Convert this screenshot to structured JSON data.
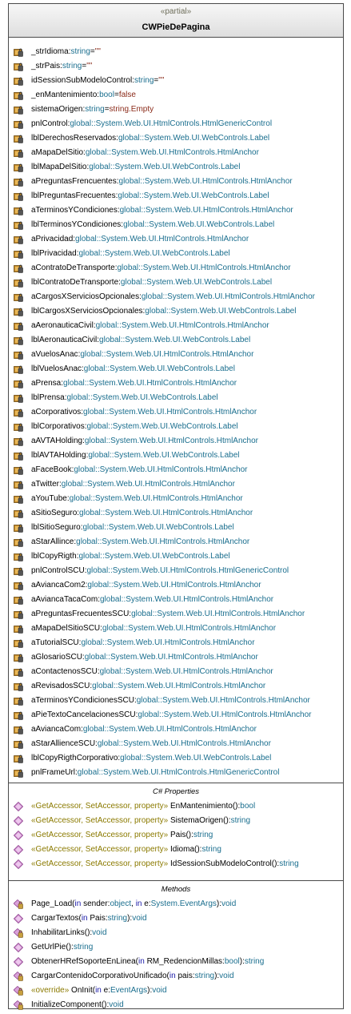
{
  "class": {
    "stereotype": "«partial»",
    "name": "CWPieDePagina"
  },
  "fields": [
    {
      "name": "_strIdioma",
      "type": "string",
      "default": "\"\""
    },
    {
      "name": "_strPais",
      "type": "string",
      "default": "\"\""
    },
    {
      "name": "idSessionSubModeloControl",
      "type": "string",
      "default": "\"\""
    },
    {
      "name": "_enMantenimiento",
      "type": "bool",
      "default": "false"
    },
    {
      "name": "sistemaOrigen",
      "type": "string",
      "default": "string.Empty"
    },
    {
      "name": "pnlControl",
      "type": "global::System.Web.UI.HtmlControls.HtmlGenericControl"
    },
    {
      "name": "lblDerechosReservados",
      "type": "global::System.Web.UI.WebControls.Label"
    },
    {
      "name": "aMapaDelSitio",
      "type": "global::System.Web.UI.HtmlControls.HtmlAnchor"
    },
    {
      "name": "lblMapaDelSitio",
      "type": "global::System.Web.UI.WebControls.Label"
    },
    {
      "name": "aPreguntasFrencuentes",
      "type": "global::System.Web.UI.HtmlControls.HtmlAnchor"
    },
    {
      "name": "lblPreguntasFrecuentes",
      "type": "global::System.Web.UI.WebControls.Label"
    },
    {
      "name": "aTerminosYCondiciones",
      "type": "global::System.Web.UI.HtmlControls.HtmlAnchor"
    },
    {
      "name": "lblTerminosYCondiciones",
      "type": "global::System.Web.UI.WebControls.Label"
    },
    {
      "name": "aPrivacidad",
      "type": "global::System.Web.UI.HtmlControls.HtmlAnchor"
    },
    {
      "name": "lblPrivacidad",
      "type": "global::System.Web.UI.WebControls.Label"
    },
    {
      "name": "aContratoDeTransporte",
      "type": "global::System.Web.UI.HtmlControls.HtmlAnchor"
    },
    {
      "name": "lblContratoDeTransporte",
      "type": "global::System.Web.UI.WebControls.Label"
    },
    {
      "name": "aCargosXServiciosOpcionales",
      "type": "global::System.Web.UI.HtmlControls.HtmlAnchor"
    },
    {
      "name": "lblCargosXServiciosOpcionales",
      "type": "global::System.Web.UI.WebControls.Label"
    },
    {
      "name": "aAeronauticaCivil",
      "type": "global::System.Web.UI.HtmlControls.HtmlAnchor"
    },
    {
      "name": "lblAeronauticaCivil",
      "type": "global::System.Web.UI.WebControls.Label"
    },
    {
      "name": "aVuelosAnac",
      "type": "global::System.Web.UI.HtmlControls.HtmlAnchor"
    },
    {
      "name": "lblVuelosAnac",
      "type": "global::System.Web.UI.WebControls.Label"
    },
    {
      "name": "aPrensa",
      "type": "global::System.Web.UI.HtmlControls.HtmlAnchor"
    },
    {
      "name": "lblPrensa",
      "type": "global::System.Web.UI.WebControls.Label"
    },
    {
      "name": "aCorporativos",
      "type": "global::System.Web.UI.HtmlControls.HtmlAnchor"
    },
    {
      "name": "lblCorporativos",
      "type": "global::System.Web.UI.WebControls.Label"
    },
    {
      "name": "aAVTAHolding",
      "type": "global::System.Web.UI.HtmlControls.HtmlAnchor"
    },
    {
      "name": "lblAVTAHolding",
      "type": "global::System.Web.UI.WebControls.Label"
    },
    {
      "name": "aFaceBook",
      "type": "global::System.Web.UI.HtmlControls.HtmlAnchor"
    },
    {
      "name": "aTwitter",
      "type": "global::System.Web.UI.HtmlControls.HtmlAnchor"
    },
    {
      "name": "aYouTube",
      "type": "global::System.Web.UI.HtmlControls.HtmlAnchor"
    },
    {
      "name": "aSitioSeguro",
      "type": "global::System.Web.UI.HtmlControls.HtmlAnchor"
    },
    {
      "name": "lblSitioSeguro",
      "type": "global::System.Web.UI.WebControls.Label"
    },
    {
      "name": "aStarAllince",
      "type": "global::System.Web.UI.HtmlControls.HtmlAnchor"
    },
    {
      "name": "lblCopyRigth",
      "type": "global::System.Web.UI.WebControls.Label"
    },
    {
      "name": "pnlControlSCU",
      "type": "global::System.Web.UI.HtmlControls.HtmlGenericControl"
    },
    {
      "name": "aAviancaCom2",
      "type": "global::System.Web.UI.HtmlControls.HtmlAnchor"
    },
    {
      "name": "aAviancaTacaCom",
      "type": "global::System.Web.UI.HtmlControls.HtmlAnchor"
    },
    {
      "name": "aPreguntasFrecuentesSCU",
      "type": "global::System.Web.UI.HtmlControls.HtmlAnchor"
    },
    {
      "name": "aMapaDelSitioSCU",
      "type": "global::System.Web.UI.HtmlControls.HtmlAnchor"
    },
    {
      "name": "aTutorialSCU",
      "type": "global::System.Web.UI.HtmlControls.HtmlAnchor"
    },
    {
      "name": "aGlosarioSCU",
      "type": "global::System.Web.UI.HtmlControls.HtmlAnchor"
    },
    {
      "name": "aContactenosSCU",
      "type": "global::System.Web.UI.HtmlControls.HtmlAnchor"
    },
    {
      "name": "aRevisadosSCU",
      "type": "global::System.Web.UI.HtmlControls.HtmlAnchor"
    },
    {
      "name": "aTerminosYCondicionesSCU",
      "type": "global::System.Web.UI.HtmlControls.HtmlAnchor"
    },
    {
      "name": "aPieTextoCancelacionesSCU",
      "type": "global::System.Web.UI.HtmlControls.HtmlAnchor"
    },
    {
      "name": "aAviancaCom",
      "type": "global::System.Web.UI.HtmlControls.HtmlAnchor"
    },
    {
      "name": "aStarAllienceSCU",
      "type": "global::System.Web.UI.HtmlControls.HtmlAnchor"
    },
    {
      "name": "lblCopyRigthCorporativo",
      "type": "global::System.Web.UI.WebControls.Label"
    },
    {
      "name": "pnlFrameUrl",
      "type": "global::System.Web.UI.HtmlControls.HtmlGenericControl"
    }
  ],
  "properties_title": "C# Properties",
  "properties": [
    {
      "stereotype": "«GetAccessor, SetAccessor, property»",
      "name": "EnMantenimiento",
      "type": "bool"
    },
    {
      "stereotype": "«GetAccessor, SetAccessor, property»",
      "name": "SistemaOrigen",
      "type": "string"
    },
    {
      "stereotype": "«GetAccessor, SetAccessor, property»",
      "name": "Pais",
      "type": "string"
    },
    {
      "stereotype": "«GetAccessor, SetAccessor, property»",
      "name": "Idioma",
      "type": "string"
    },
    {
      "stereotype": "«GetAccessor, SetAccessor, property»",
      "name": "IdSessionSubModeloControl",
      "type": "string"
    }
  ],
  "methods_title": "Methods",
  "methods": [
    {
      "icon": "protected",
      "stereotype": "",
      "name": "Page_Load",
      "params": [
        {
          "kw": "in",
          "name": "sender",
          "type": "object"
        },
        {
          "kw": "in",
          "name": "e",
          "type": "System.EventArgs"
        }
      ],
      "ret": "void"
    },
    {
      "icon": "public",
      "stereotype": "",
      "name": "CargarTextos",
      "params": [
        {
          "kw": "in",
          "name": "Pais",
          "type": "string"
        }
      ],
      "ret": "void"
    },
    {
      "icon": "protected",
      "stereotype": "",
      "name": "InhabilitarLinks",
      "params": [],
      "ret": "void"
    },
    {
      "icon": "public",
      "stereotype": "",
      "name": "GetUrlPie",
      "params": [],
      "ret": "string"
    },
    {
      "icon": "public",
      "stereotype": "",
      "name": "ObtenerHRefSoporteEnLinea",
      "params": [
        {
          "kw": "in",
          "name": "RM_RedencionMillas",
          "type": "bool"
        }
      ],
      "ret": "string"
    },
    {
      "icon": "protected",
      "stereotype": "",
      "name": "CargarContenidoCorporativoUnificado",
      "params": [
        {
          "kw": "in",
          "name": "pais",
          "type": "string"
        }
      ],
      "ret": "void"
    },
    {
      "icon": "protected",
      "stereotype": "«override»",
      "name": "OnInit",
      "params": [
        {
          "kw": "in",
          "name": "e",
          "type": "EventArgs"
        }
      ],
      "ret": "void"
    },
    {
      "icon": "protected",
      "stereotype": "",
      "name": "InitializeComponent",
      "params": [],
      "ret": "void"
    }
  ]
}
